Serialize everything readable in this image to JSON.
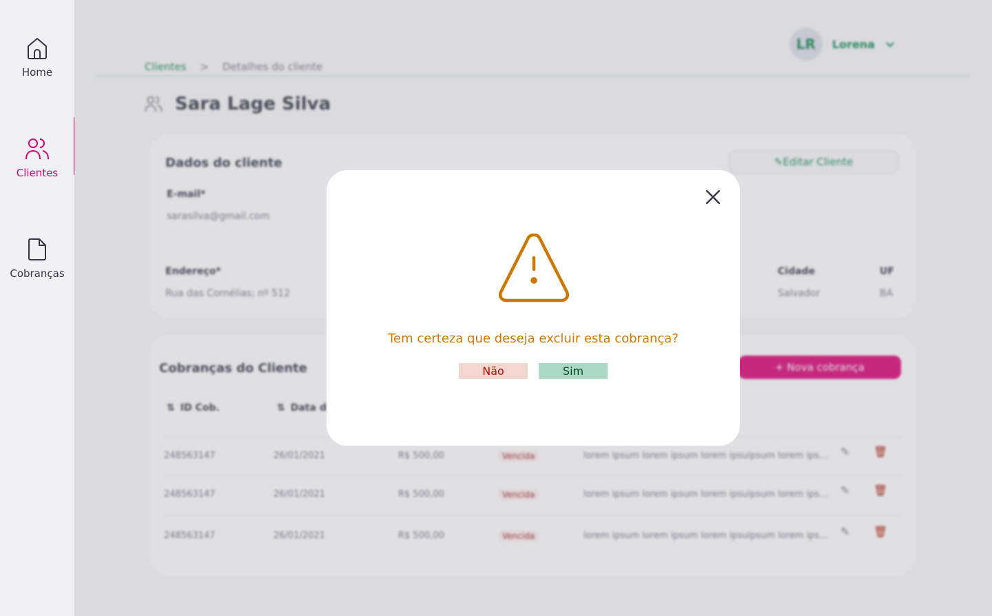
{
  "sidebar": {
    "items": [
      {
        "label": "Home",
        "icon": "home-icon",
        "active": false
      },
      {
        "label": "Clientes",
        "icon": "users-icon",
        "active": true
      },
      {
        "label": "Cobranças",
        "icon": "file-icon",
        "active": false
      }
    ]
  },
  "header": {
    "user_initials": "LR",
    "user_name": "Lorena"
  },
  "breadcrumb": {
    "root": "Clientes",
    "separator": ">",
    "current": "Detalhes do cliente"
  },
  "page": {
    "title": "Sara Lage Silva"
  },
  "client_card": {
    "title": "Dados do cliente",
    "edit_label": "Editar Cliente",
    "email_label": "E-mail*",
    "email_value": "sarasilva@gmail.com",
    "address_label": "Endereço*",
    "address_value": "Rua das Cornélias; nº 512",
    "city_label": "Cidade",
    "city_value": "Salvador",
    "uf_label": "UF",
    "uf_value": "BA"
  },
  "charges_card": {
    "title": "Cobranças do Cliente",
    "new_charge_label": "+ Nova cobrança",
    "columns": [
      "ID Cob.",
      "Data de venc."
    ],
    "rows": [
      {
        "id": "248563147",
        "date": "26/01/2021",
        "value": "R$ 500,00",
        "status": "Vencida",
        "description": "lorem ipsum  lorem ipsum lorem ipsuipsum lorem ips..."
      },
      {
        "id": "248563147",
        "date": "26/01/2021",
        "value": "R$ 500,00",
        "status": "Vencida",
        "description": "lorem ipsum  lorem ipsum lorem ipsuipsum lorem ips..."
      },
      {
        "id": "248563147",
        "date": "26/01/2021",
        "value": "R$ 500,00",
        "status": "Vencida",
        "description": "lorem ipsum  lorem ipsum lorem ipsuipsum lorem ips..."
      }
    ],
    "edit_action": "Editar",
    "delete_action": "Excluir"
  },
  "modal": {
    "question": "Tem certeza que deseja excluir esta cobrança?",
    "no_label": "Não",
    "yes_label": "Sim",
    "accent_color": "#cc7800"
  },
  "colors": {
    "primary_pink": "#da0175",
    "green": "#0e8750",
    "warning": "#cc7800"
  }
}
